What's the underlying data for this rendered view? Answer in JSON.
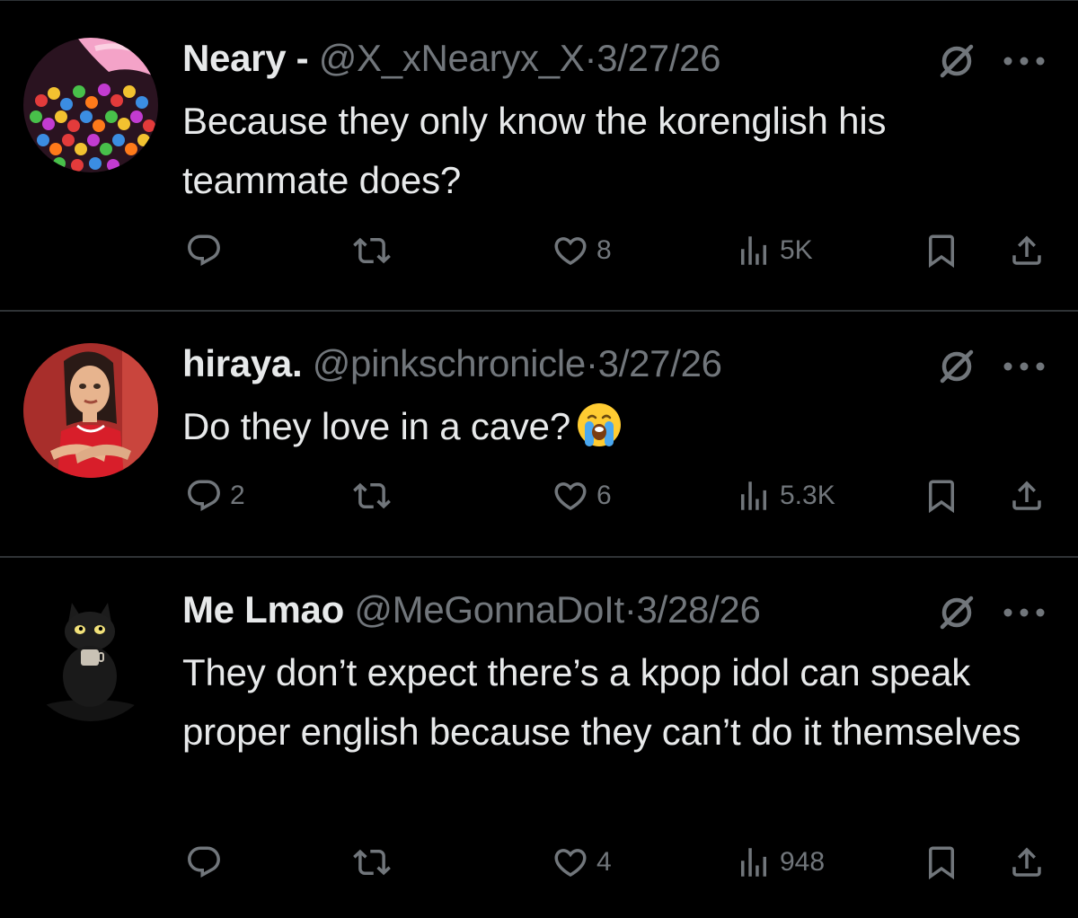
{
  "colors": {
    "background": "#000000",
    "text": "#e7e9ea",
    "muted": "#71767b",
    "divider": "#2f3336"
  },
  "posts": [
    {
      "name": "Neary -",
      "handle": "@X_xNearyx_X",
      "separator": "·",
      "date": "3/27/26",
      "text": "Because they only know the korenglish his teammate does?",
      "emoji": "",
      "avatar": "candy-avatar",
      "reply_count": "",
      "like_count": "8",
      "view_count": "5K"
    },
    {
      "name": "hiraya.",
      "handle": "@pinkschronicle",
      "separator": "·",
      "date": "3/27/26",
      "text": "Do they love in a cave?",
      "emoji": "loudly-crying-face-emoji",
      "avatar": "cartoon-woman-avatar",
      "reply_count": "2",
      "like_count": "6",
      "view_count": "5.3K"
    },
    {
      "name": "Me Lmao",
      "handle": "@MeGonnaDoIt",
      "separator": "·",
      "date": "3/28/26",
      "text": "They don’t expect there’s a kpop idol can speak proper english because they can’t do it themselves",
      "emoji": "",
      "avatar": "black-cat-avatar",
      "reply_count": "",
      "like_count": "4",
      "view_count": "948"
    }
  ],
  "icons": {
    "reply": "reply-icon",
    "repost": "repost-icon",
    "like": "like-icon",
    "views": "views-icon",
    "bookmark": "bookmark-icon",
    "share": "share-icon",
    "mute": "mute-icon",
    "more": "more-icon"
  }
}
